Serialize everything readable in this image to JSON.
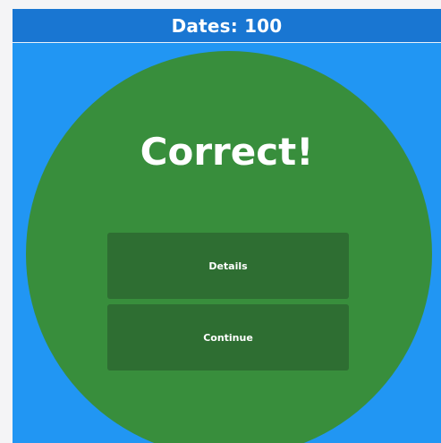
{
  "header": {
    "title": "Dates: 100"
  },
  "result": {
    "message": "Correct!"
  },
  "actions": {
    "details_label": "Details",
    "continue_label": "Continue"
  },
  "colors": {
    "page_background": "#f4f4f6",
    "app_background": "#2196f3",
    "header_background": "#1976d2",
    "circle": "#388e3c",
    "button": "#2e6e32",
    "text": "#ffffff"
  }
}
